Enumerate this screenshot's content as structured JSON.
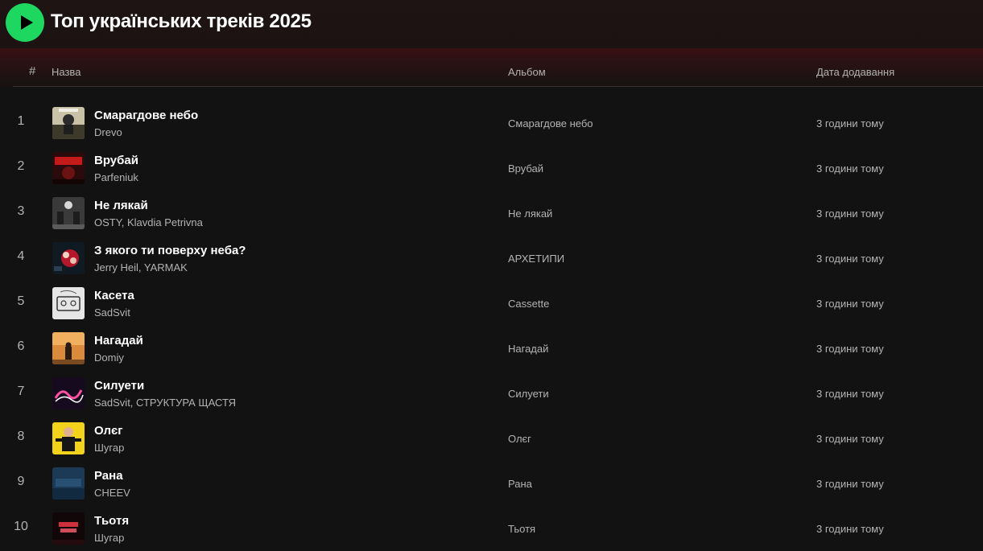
{
  "playlist": {
    "title": "Топ українських треків 2025",
    "accent_color": "#1ed760"
  },
  "columns": {
    "number": "#",
    "title": "Назва",
    "album": "Альбом",
    "date_added": "Дата додавання"
  },
  "tracks": [
    {
      "number": "1",
      "title": "Смарагдове небо",
      "artist": "Drevo",
      "album": "Смарагдове небо",
      "added": "3 години тому",
      "cover": "cover-smarahdove-nebo"
    },
    {
      "number": "2",
      "title": "Врубай",
      "artist": "Parfeniuk",
      "album": "Врубай",
      "added": "3 години тому",
      "cover": "cover-vrubai"
    },
    {
      "number": "3",
      "title": "Не лякай",
      "artist": "OSTY, Klavdia Petrivna",
      "album": "Не лякай",
      "added": "3 години тому",
      "cover": "cover-ne-liakai"
    },
    {
      "number": "4",
      "title": "З якого ти поверху неба?",
      "artist": "Jerry Heil, YARMAK",
      "album": "АРХЕТИПИ",
      "added": "3 години тому",
      "cover": "cover-arkhetypy"
    },
    {
      "number": "5",
      "title": "Касета",
      "artist": "SadSvit",
      "album": "Cassette",
      "added": "3 години тому",
      "cover": "cover-cassette"
    },
    {
      "number": "6",
      "title": "Нагадай",
      "artist": "Domiy",
      "album": "Нагадай",
      "added": "3 години тому",
      "cover": "cover-nahadai"
    },
    {
      "number": "7",
      "title": "Силуети",
      "artist": "SadSvit, СТРУКТУРА ЩАСТЯ",
      "album": "Силуети",
      "added": "3 години тому",
      "cover": "cover-syluety"
    },
    {
      "number": "8",
      "title": "Олєг",
      "artist": "Шугар",
      "album": "Олєг",
      "added": "3 години тому",
      "cover": "cover-oleh"
    },
    {
      "number": "9",
      "title": "Рана",
      "artist": "CHEEV",
      "album": "Рана",
      "added": "3 години тому",
      "cover": "cover-rana"
    },
    {
      "number": "10",
      "title": "Тьотя",
      "artist": "Шугар",
      "album": "Тьотя",
      "added": "3 години тому",
      "cover": "cover-totia"
    }
  ]
}
